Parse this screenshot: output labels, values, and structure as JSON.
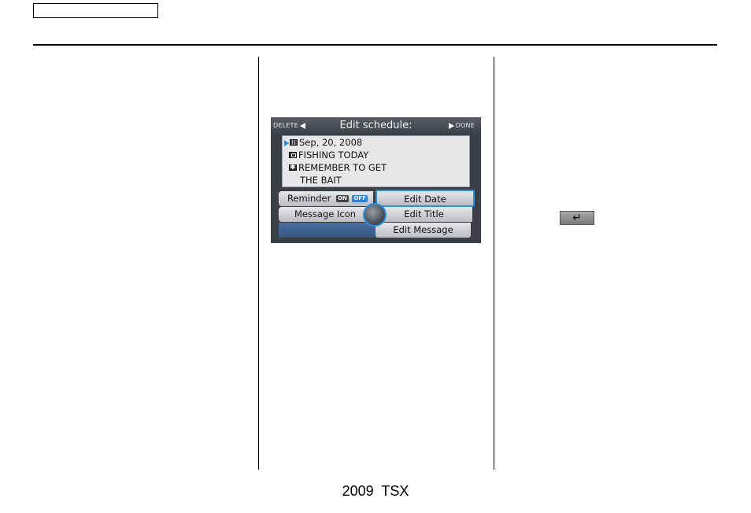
{
  "footer": {
    "model": "2009  TSX"
  },
  "enter_key": {
    "glyph": "↵"
  },
  "screen": {
    "title": "Edit schedule:",
    "delete_label": "DELETE",
    "done_label": "DONE",
    "entry": {
      "date": "Sep, 20, 2008",
      "title": "FISHING TODAY",
      "message_line1": "REMEMBER TO GET",
      "message_line2": "THE BAIT"
    },
    "menu": {
      "reminder_label": "Reminder",
      "reminder_on": "ON",
      "reminder_off": "OFF",
      "message_icon": "Message Icon",
      "edit_date": "Edit Date",
      "edit_title": "Edit Title",
      "edit_message": "Edit Message"
    },
    "colors": {
      "highlight": "#2a8fe6",
      "panel": "#3b3e45"
    }
  }
}
